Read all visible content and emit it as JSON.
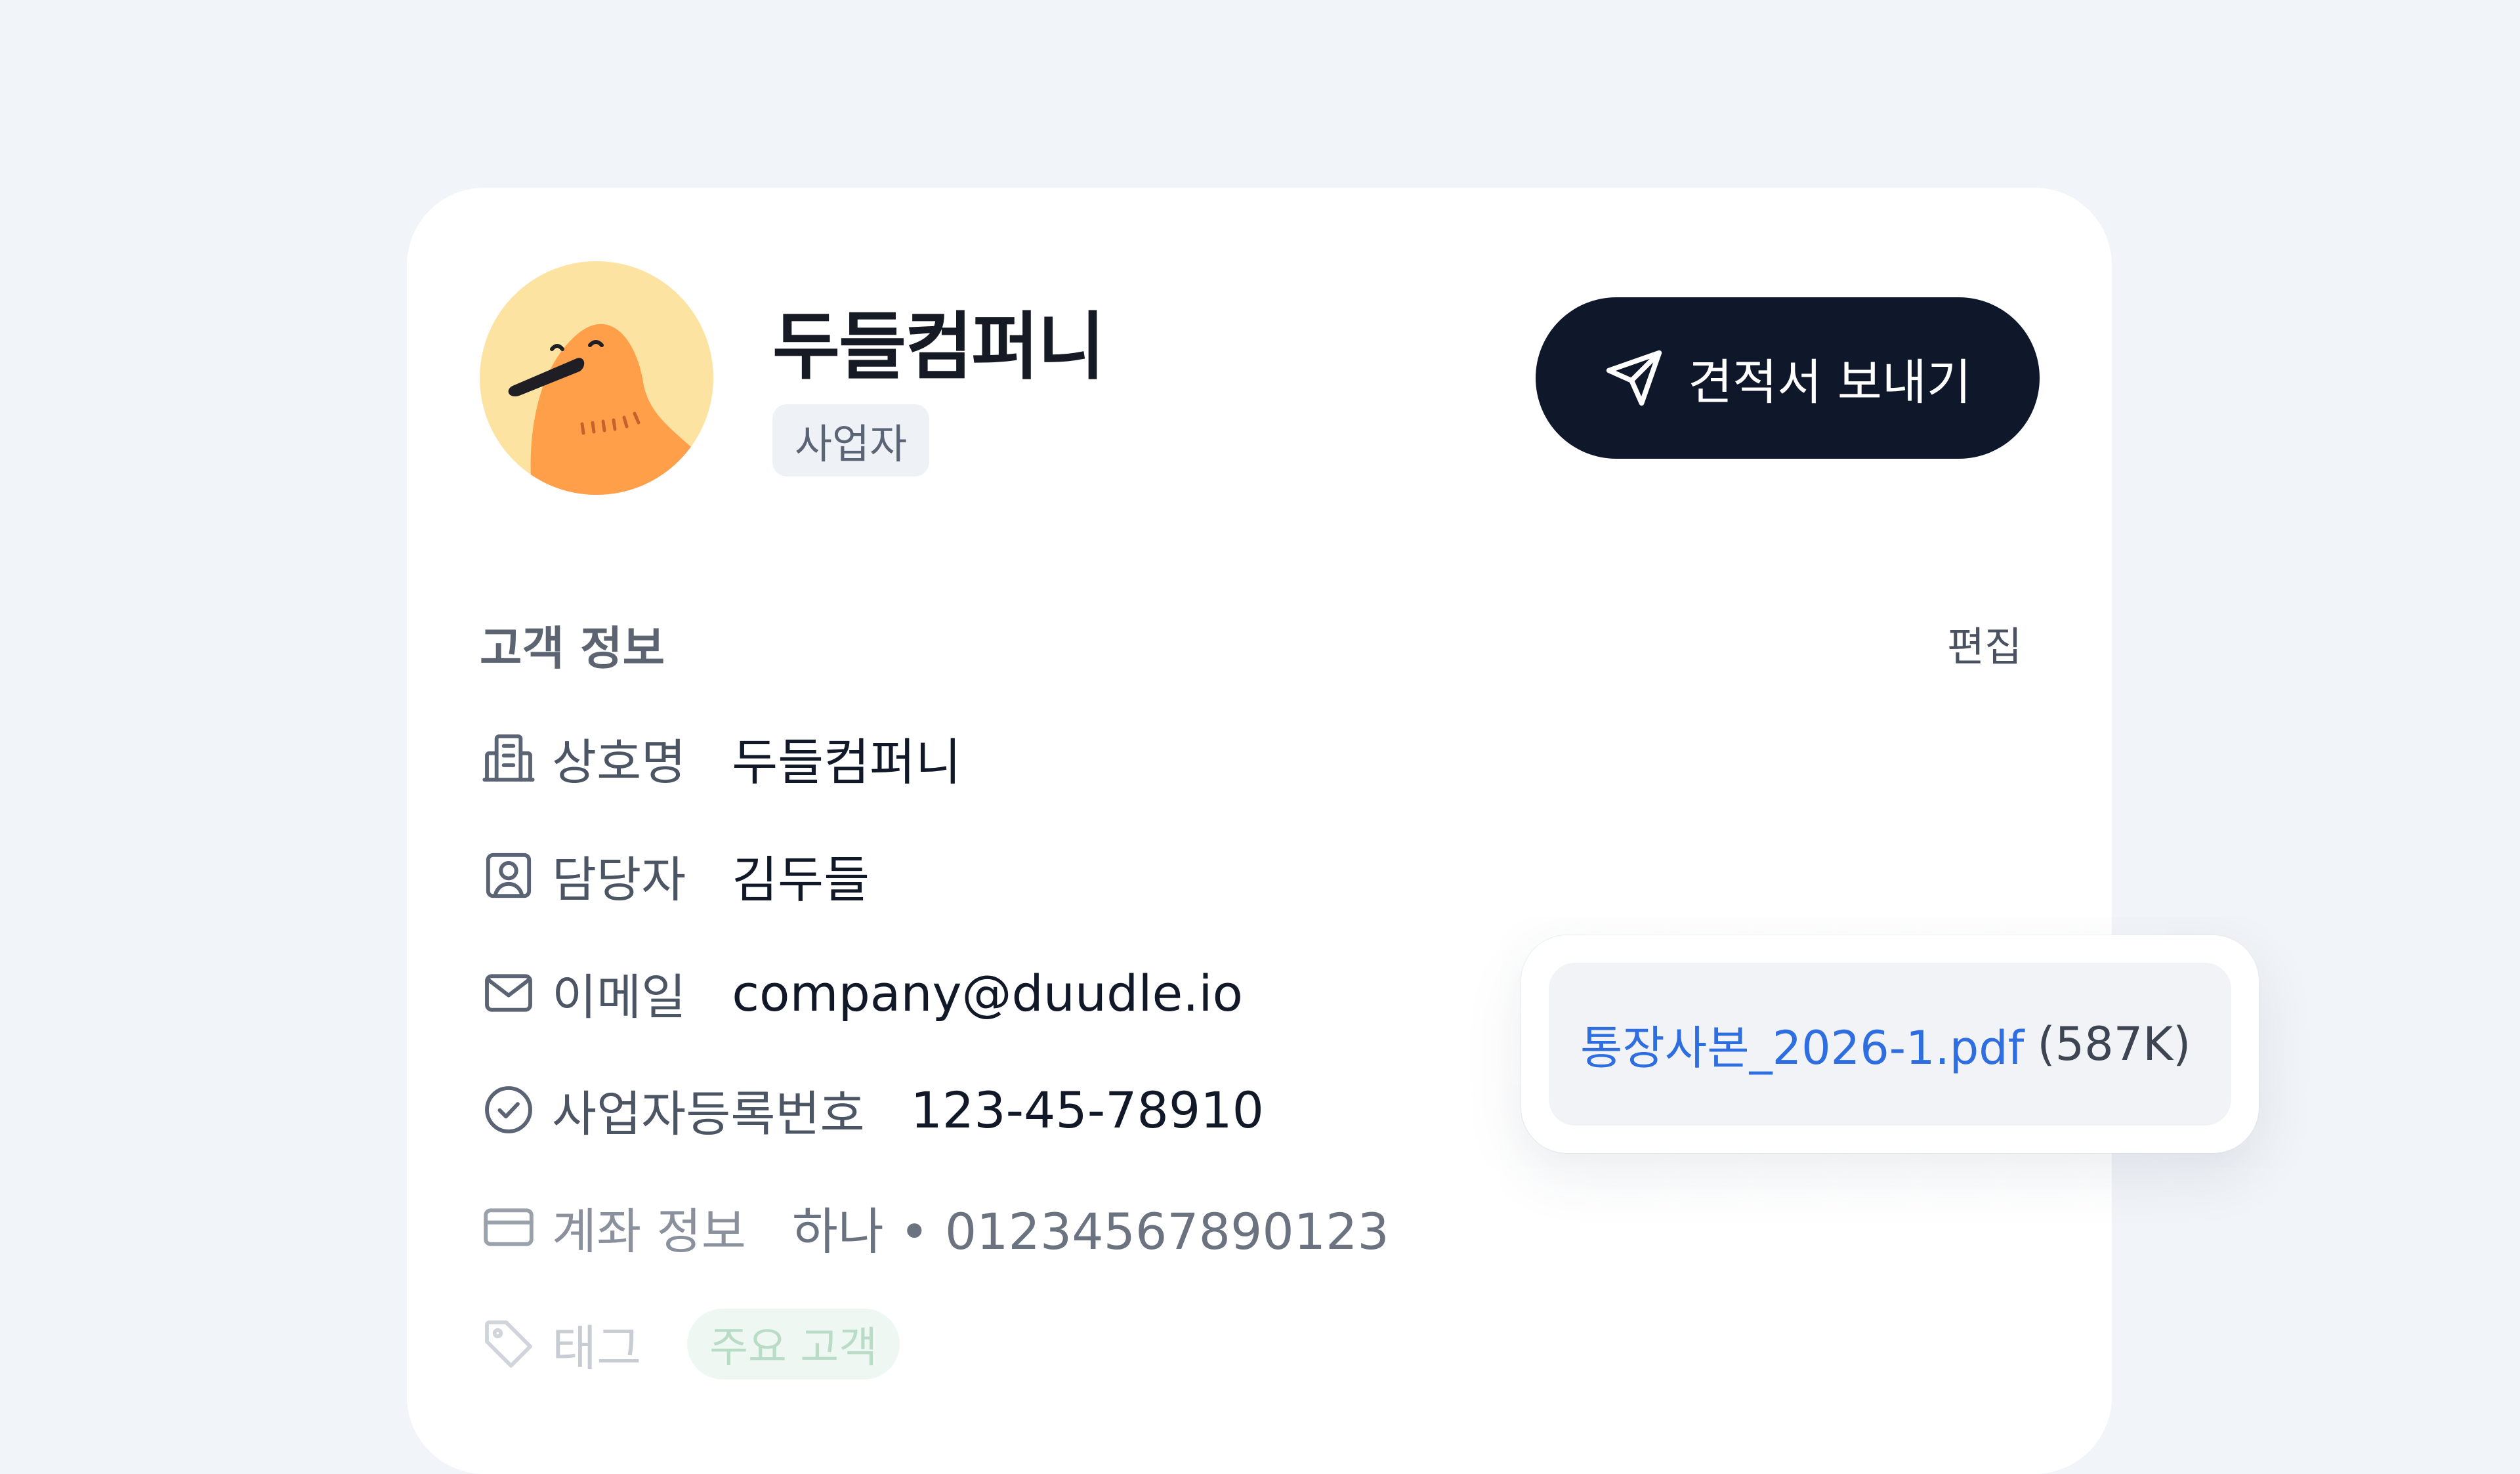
{
  "profile": {
    "name": "두들컴퍼니",
    "type_badge": "사업자",
    "send_button_label": "견적서 보내기"
  },
  "customer_info": {
    "title": "고객 정보",
    "edit_label": "편집",
    "rows": [
      {
        "icon": "building-icon",
        "label": "상호명",
        "value": "두들컴퍼니"
      },
      {
        "icon": "contact-person-icon",
        "label": "담당자",
        "value": "김두들"
      },
      {
        "icon": "mail-icon",
        "label": "이메일",
        "value": "company@duudle.io"
      },
      {
        "icon": "check-circle-icon",
        "label": "사업자등록번호",
        "value": "123-45-78910"
      },
      {
        "icon": "credit-card-icon",
        "label": "계좌 정보",
        "value": "하나 • 01234567890123"
      },
      {
        "icon": "tag-icon",
        "label": "태그",
        "value": "주요 고객"
      }
    ]
  },
  "attachment": {
    "file_name": "통장사본_2026-1.pdf",
    "file_size": "(587K)"
  },
  "colors": {
    "background": "#f1f4f8",
    "button": "#0f172a",
    "link": "#2f6ee0",
    "avatar_bg": "#fde3a1",
    "avatar_bird": "#ff9f4a",
    "tag_bg": "#eef7f1"
  }
}
